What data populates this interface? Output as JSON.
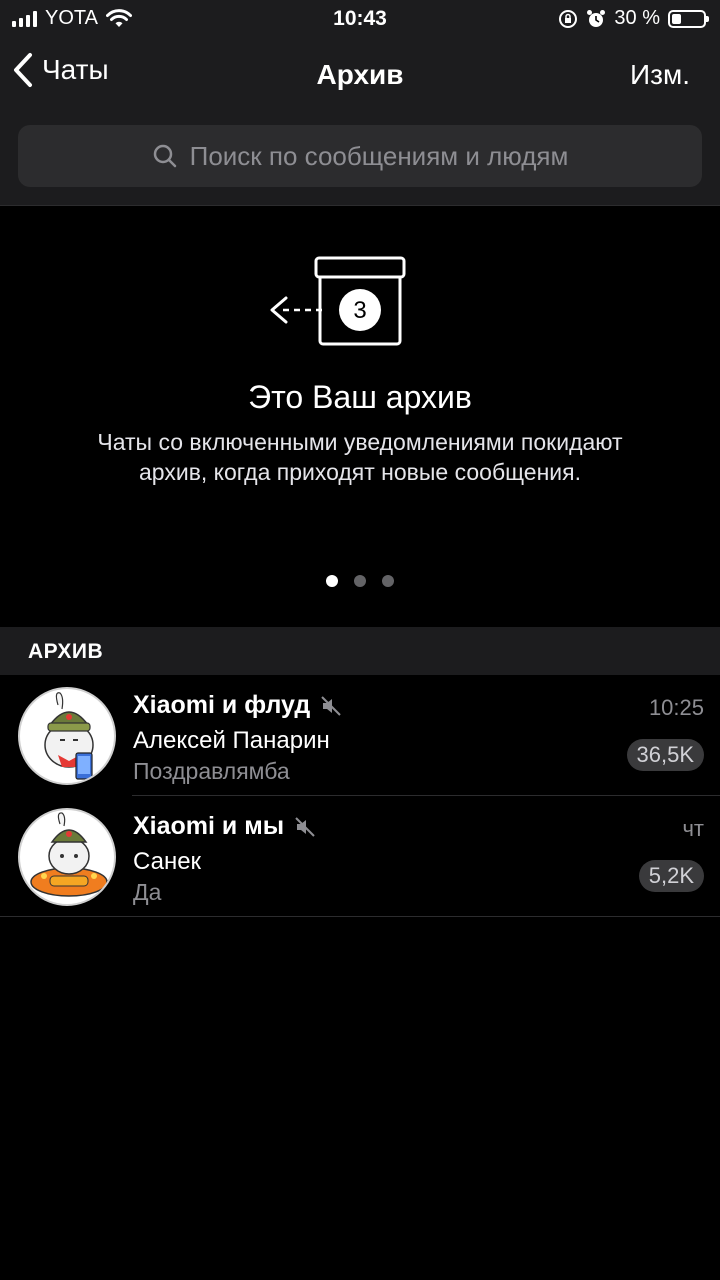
{
  "status_bar": {
    "carrier": "YOTA",
    "time": "10:43",
    "battery": "30 %",
    "battery_level": 0.3
  },
  "nav": {
    "back_label": "Чаты",
    "title": "Архив",
    "edit_label": "Изм."
  },
  "search": {
    "placeholder": "Поиск по сообщениям и людям"
  },
  "info": {
    "badge_number": "3",
    "heading": "Это Ваш архив",
    "description": "Чаты со включенными уведомлениями покидают архив, когда приходят новые сообщения.",
    "page_count": 3,
    "active_page": 1
  },
  "section": {
    "label": "АРХИВ"
  },
  "chats": [
    {
      "name": "Xiaomi и флуд",
      "muted": true,
      "sender": "Алексей Панарин",
      "message": "Поздравлямба",
      "time": "10:25",
      "unread": "36,5K"
    },
    {
      "name": "Xiaomi и мы",
      "muted": true,
      "sender": "Санек",
      "message": "Да",
      "time": "чт",
      "unread": "5,2K"
    }
  ],
  "colors": {
    "background": "#000000",
    "bar": "#1c1c1e",
    "secondary_text": "#8e8e93",
    "badge": "#3a3a3c"
  }
}
